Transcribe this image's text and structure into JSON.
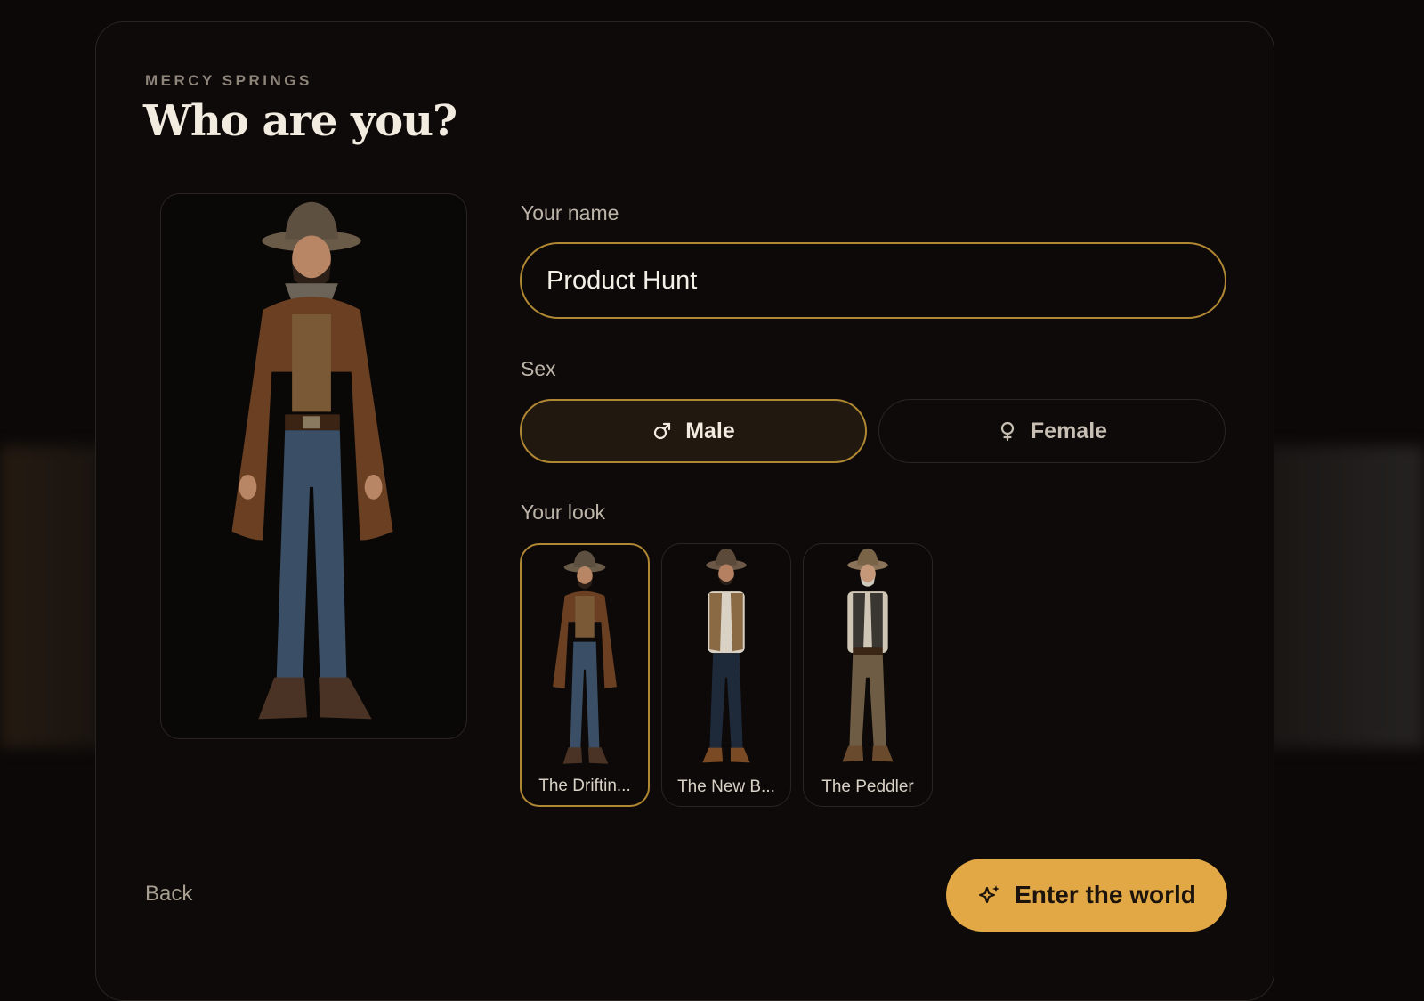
{
  "world_name": "MERCY SPRINGS",
  "heading": "Who are you?",
  "name_field": {
    "label": "Your name",
    "value": "Product Hunt"
  },
  "sex": {
    "label": "Sex",
    "options": [
      {
        "label": "Male",
        "icon": "male-symbol-icon",
        "selected": true
      },
      {
        "label": "Female",
        "icon": "female-symbol-icon",
        "selected": false
      }
    ]
  },
  "look": {
    "label": "Your look",
    "options": [
      {
        "name": "The Driftin...",
        "selected": true
      },
      {
        "name": "The New B...",
        "selected": false
      },
      {
        "name": "The Peddler",
        "selected": false
      }
    ]
  },
  "actions": {
    "back": "Back",
    "enter": "Enter the world"
  },
  "colors": {
    "accent": "#e1a845",
    "accent_border": "#b08733",
    "panel": "#0e0a09"
  }
}
